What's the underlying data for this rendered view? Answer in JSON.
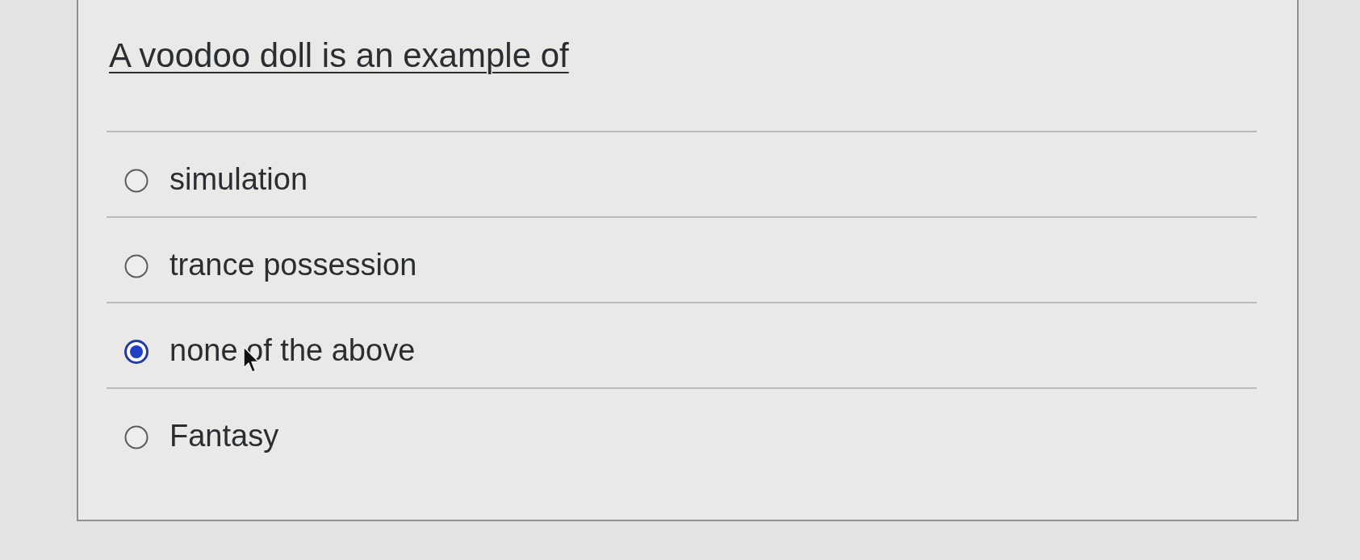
{
  "question": {
    "title": "A voodoo doll is an example of"
  },
  "options": [
    {
      "label": "simulation",
      "selected": false
    },
    {
      "label": "trance possession",
      "selected": false
    },
    {
      "label": "none of the above",
      "selected": true
    },
    {
      "label": "Fantasy",
      "selected": false
    }
  ]
}
